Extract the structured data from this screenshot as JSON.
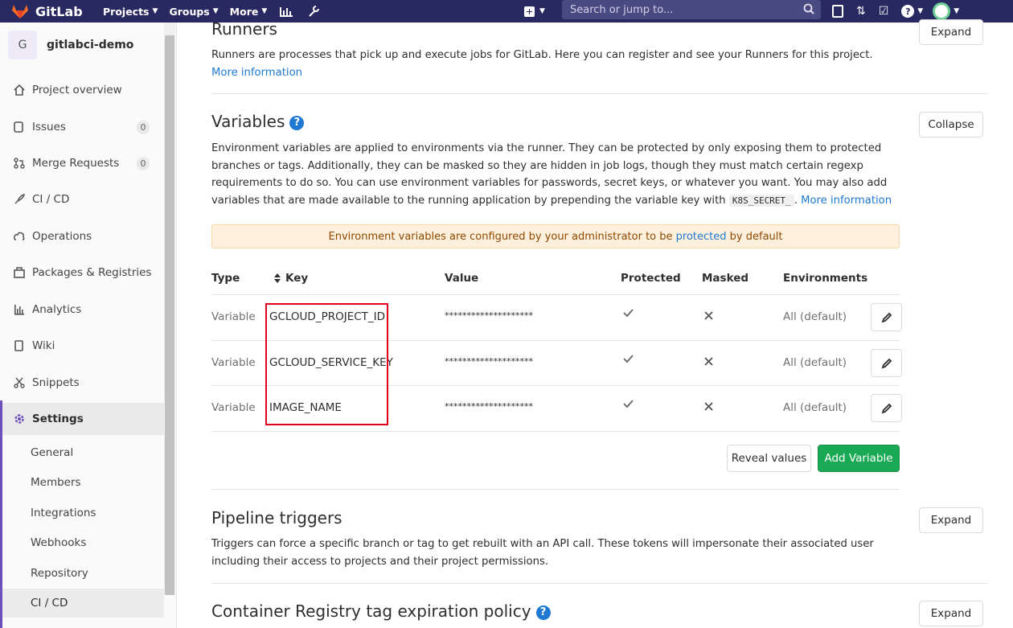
{
  "topbar": {
    "brand": "GitLab",
    "nav": [
      {
        "label": "Projects"
      },
      {
        "label": "Groups"
      },
      {
        "label": "More"
      }
    ],
    "search_placeholder": "Search or jump to..."
  },
  "sidebar": {
    "project_initial": "G",
    "project_name": "gitlabci-demo",
    "items": [
      {
        "label": "Project overview",
        "icon": "home-icon"
      },
      {
        "label": "Issues",
        "icon": "issues-icon",
        "count": "0"
      },
      {
        "label": "Merge Requests",
        "icon": "merge-request-icon",
        "count": "0"
      },
      {
        "label": "CI / CD",
        "icon": "rocket-icon"
      },
      {
        "label": "Operations",
        "icon": "cloud-gear-icon"
      },
      {
        "label": "Packages & Registries",
        "icon": "package-icon"
      },
      {
        "label": "Analytics",
        "icon": "chart-icon"
      },
      {
        "label": "Wiki",
        "icon": "book-icon"
      },
      {
        "label": "Snippets",
        "icon": "scissors-icon"
      },
      {
        "label": "Settings",
        "icon": "gear-icon"
      }
    ],
    "settings_sub": [
      {
        "label": "General"
      },
      {
        "label": "Members"
      },
      {
        "label": "Integrations"
      },
      {
        "label": "Webhooks"
      },
      {
        "label": "Repository"
      },
      {
        "label": "CI / CD"
      }
    ]
  },
  "runners": {
    "title": "Runners",
    "desc": "Runners are processes that pick up and execute jobs for GitLab. Here you can register and see your Runners for this project.",
    "more_link": "More information",
    "button": "Expand"
  },
  "variables": {
    "title": "Variables",
    "desc_1": "Environment variables are applied to environments via the runner. They can be protected by only exposing them to protected branches or tags. Additionally, they can be masked so they are hidden in job logs, though they must match certain regexp requirements to do so. You can use environment variables for passwords, secret keys, or whatever you want. You may also add variables that are made available to the running application by prepending the variable key with",
    "code": "K8S_SECRET_",
    "desc_2": ".",
    "more_link": "More information",
    "button": "Collapse",
    "alert_pre": "Environment variables are configured by your administrator to be",
    "alert_link": "protected",
    "alert_post": "by default",
    "columns": [
      "Type",
      "Key",
      "Value",
      "Protected",
      "Masked",
      "Environments"
    ],
    "rows": [
      {
        "type": "Variable",
        "key": "GCLOUD_PROJECT_ID",
        "value": "********************",
        "env": "All (default)"
      },
      {
        "type": "Variable",
        "key": "GCLOUD_SERVICE_KEY",
        "value": "********************",
        "env": "All (default)"
      },
      {
        "type": "Variable",
        "key": "IMAGE_NAME",
        "value": "********************",
        "env": "All (default)"
      }
    ],
    "reveal_button": "Reveal values",
    "add_button": "Add Variable"
  },
  "triggers": {
    "title": "Pipeline triggers",
    "desc": "Triggers can force a specific branch or tag to get rebuilt with an API call. These tokens will impersonate their associated user including their access to projects and their project permissions.",
    "button": "Expand"
  },
  "registry": {
    "title": "Container Registry tag expiration policy",
    "button": "Expand"
  },
  "colors": {
    "topbar": "#292961",
    "link": "#1f78d1",
    "add_button": "#1aaa55",
    "highlight": "#e0001b"
  }
}
